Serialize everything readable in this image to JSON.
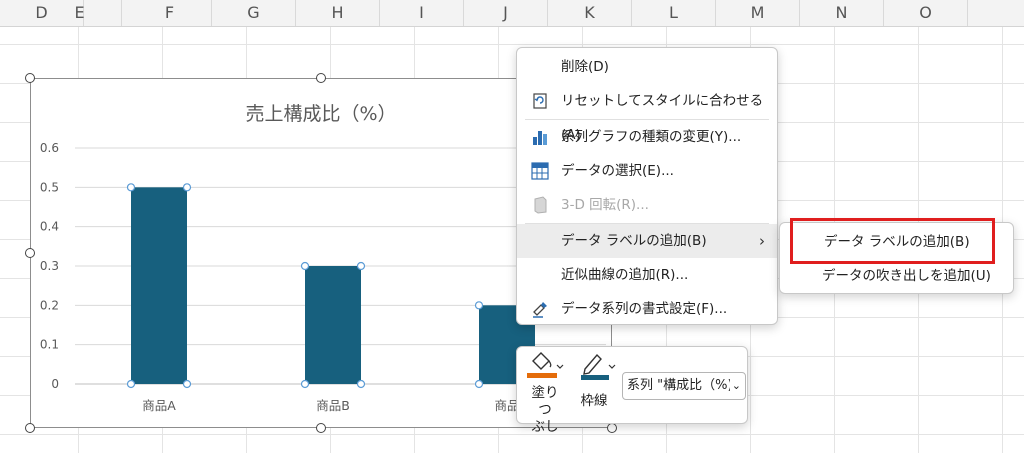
{
  "columns": [
    "D",
    "E",
    "F",
    "G",
    "H",
    "I",
    "J",
    "K",
    "L",
    "M",
    "N",
    "O"
  ],
  "chart_data": {
    "type": "bar",
    "title": "売上構成比（%）",
    "categories": [
      "商品A",
      "商品B",
      "商品C"
    ],
    "values": [
      0.5,
      0.3,
      0.2
    ],
    "ylim": [
      0,
      0.6
    ],
    "yticks": [
      "0",
      "0.1",
      "0.2",
      "0.3",
      "0.4",
      "0.5",
      "0.6"
    ],
    "xtick_labels": [
      "商品A",
      "商品B",
      "商品"
    ],
    "bar_color": "#17607e",
    "grid": true
  },
  "context_menu": {
    "items": [
      {
        "label": "削除(D)",
        "icon": "delete-icon",
        "enabled": true
      },
      {
        "label": "リセットしてスタイルに合わせる(A)",
        "icon": "reset-style-icon",
        "enabled": true
      },
      {
        "label": "系列グラフの種類の変更(Y)...",
        "icon": "chart-type-icon",
        "enabled": true
      },
      {
        "label": "データの選択(E)...",
        "icon": "select-data-icon",
        "enabled": true
      },
      {
        "label": "3-D 回転(R)...",
        "icon": "3d-rotation-icon",
        "enabled": false
      },
      {
        "label": "データ ラベルの追加(B)",
        "icon": "",
        "enabled": true,
        "submenu": true
      },
      {
        "label": "近似曲線の追加(R)...",
        "icon": "",
        "enabled": true
      },
      {
        "label": "データ系列の書式設定(F)...",
        "icon": "format-series-icon",
        "enabled": true
      }
    ],
    "submenu_arrow": "›"
  },
  "submenu": {
    "items": [
      {
        "label": "データ ラベルの追加(B)"
      },
      {
        "label": "データの吹き出しを追加(U)"
      }
    ]
  },
  "mini_toolbar": {
    "fill_label_1": "塗りつ",
    "fill_label_2": "ぶし",
    "outline_label": "枠線",
    "series_dropdown": "系列 \"構成比（%)",
    "fill_color": "#e46c0a",
    "outline_color": "#17607e"
  },
  "colors": {
    "highlight_box": "#e01e1e",
    "bar": "#17607e"
  }
}
